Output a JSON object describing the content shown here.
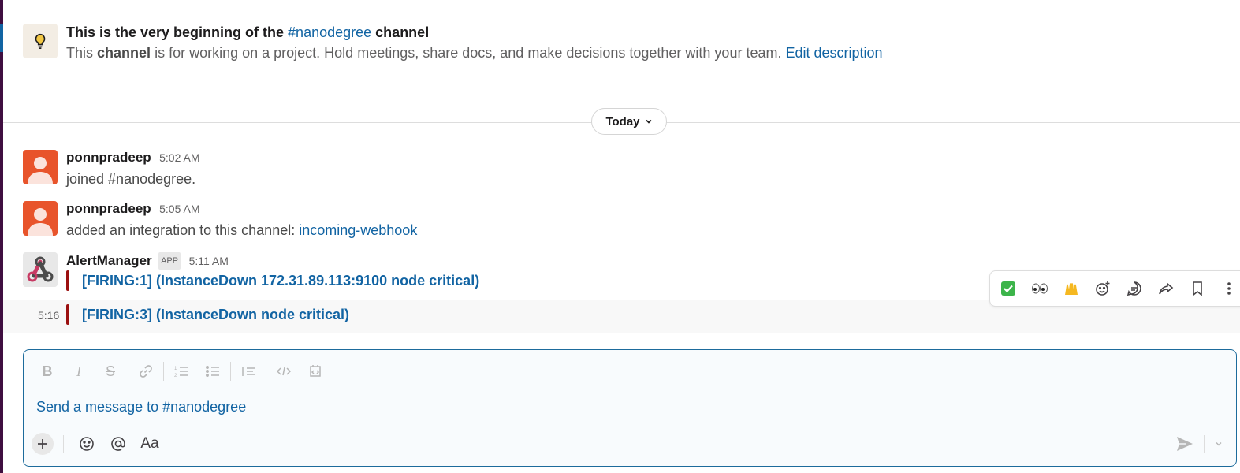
{
  "intro": {
    "title_prefix": "This is the very beginning of the",
    "channel_link": "#nanodegree",
    "title_suffix": "channel",
    "desc_prefix": "This",
    "desc_bold": "channel",
    "desc_rest": "is for working on a project. Hold meetings, share docs, and make decisions together with your team.",
    "edit_link": "Edit description"
  },
  "divider": {
    "label": "Today"
  },
  "messages": [
    {
      "author": "ponnpradeep",
      "time": "5:02 AM",
      "text": "joined #nanodegree."
    },
    {
      "author": "ponnpradeep",
      "time": "5:05 AM",
      "text_prefix": "added an integration to this channel:",
      "link": "incoming-webhook"
    },
    {
      "author": "AlertManager",
      "badge": "APP",
      "time": "5:11 AM",
      "attachment": "[FIRING:1]  (InstanceDown 172.31.89.113:9100 node critical)"
    }
  ],
  "followup": {
    "time": "5:16",
    "attachment": "[FIRING:3]  (InstanceDown node critical)"
  },
  "composer": {
    "placeholder": "Send a message to #nanodegree",
    "format_label": "Aa"
  },
  "colors": {
    "accent": "#1264a3",
    "alert_bar": "#9b1010",
    "avatar_orange": "#e8542b"
  },
  "icons": {
    "actions": [
      "check-mark-emoji-icon",
      "eyes-emoji-icon",
      "raised-hands-emoji-icon",
      "add-reaction-icon",
      "reply-in-thread-icon",
      "share-icon",
      "bookmark-icon",
      "more-actions-icon"
    ]
  }
}
